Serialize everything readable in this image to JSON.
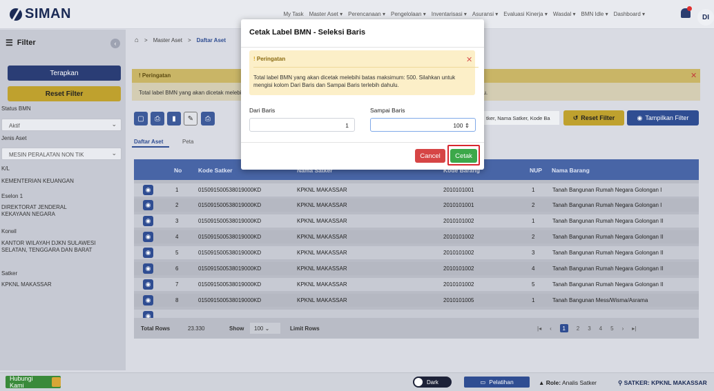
{
  "app": {
    "logo_text": "SIMAN"
  },
  "nav": {
    "items": [
      "My Task",
      "Master Aset ▾",
      "Perencanaan ▾",
      "Pengelolaan ▾",
      "Inventarisasi ▾",
      "Asuransi ▾",
      "Evaluasi Kinerja ▾",
      "Wasdal ▾",
      "BMN Idle ▾",
      "Dashboard ▾"
    ],
    "avatar": "DI"
  },
  "sidebar": {
    "title": "Filter",
    "terapkan": "Terapkan",
    "reset": "Reset Filter",
    "status_label": "Status BMN",
    "status_value": "Aktif",
    "jenis_label": "Jenis Aset",
    "jenis_value": "MESIN PERALATAN NON TIK",
    "kl_label": "K/L",
    "kl_value": "KEMENTERIAN KEUANGAN",
    "eselon_label": "Eselon 1",
    "eselon_value": "DIREKTORAT JENDERAL KEKAYAAN NEGARA",
    "korwil_label": "Korwil",
    "korwil_value": "KANTOR WILAYAH DJKN SULAWESI SELATAN, TENGGARA DAN BARAT",
    "satker_label": "Satker",
    "satker_value": "KPKNL MAKASSAR"
  },
  "breadcrumb": {
    "home": "⌂",
    "sep": ">",
    "item1": "Master Aset",
    "item2": "Daftar Aset"
  },
  "warning_bar": {
    "title": "Peringatan",
    "text": "Total label BMN yang akan dicetak melebihi batas maksimum: 500. Silahkan untuk mengisi kolom Dari Baris dan Sampai Baris terlebih dahulu."
  },
  "toolbar": {
    "search_placeholder": "tker, Nama Satker, Kode Ba",
    "reset_filter": "Reset Filter",
    "tampilkan_filter": "Tampilkan Filter"
  },
  "tabs": {
    "active": "Daftar Aset",
    "other": "Peta"
  },
  "table": {
    "headers": {
      "no": "No",
      "kode_satker": "Kode Satker",
      "nama_satker": "Nama Satker",
      "kode_barang": "Kode Barang",
      "nup": "NUP",
      "nama_barang": "Nama Barang"
    },
    "rows": [
      {
        "no": "1",
        "kode_satker": "015091500538019000KD",
        "nama_satker": "KPKNL MAKASSAR",
        "kode_barang": "2010101001",
        "nup": "1",
        "nama_barang": "Tanah Bangunan Rumah Negara Golongan I"
      },
      {
        "no": "2",
        "kode_satker": "015091500538019000KD",
        "nama_satker": "KPKNL MAKASSAR",
        "kode_barang": "2010101001",
        "nup": "2",
        "nama_barang": "Tanah Bangunan Rumah Negara Golongan I"
      },
      {
        "no": "3",
        "kode_satker": "015091500538019000KD",
        "nama_satker": "KPKNL MAKASSAR",
        "kode_barang": "2010101002",
        "nup": "1",
        "nama_barang": "Tanah Bangunan Rumah Negara Golongan II"
      },
      {
        "no": "4",
        "kode_satker": "015091500538019000KD",
        "nama_satker": "KPKNL MAKASSAR",
        "kode_barang": "2010101002",
        "nup": "2",
        "nama_barang": "Tanah Bangunan Rumah Negara Golongan II"
      },
      {
        "no": "5",
        "kode_satker": "015091500538019000KD",
        "nama_satker": "KPKNL MAKASSAR",
        "kode_barang": "2010101002",
        "nup": "3",
        "nama_barang": "Tanah Bangunan Rumah Negara Golongan II"
      },
      {
        "no": "6",
        "kode_satker": "015091500538019000KD",
        "nama_satker": "KPKNL MAKASSAR",
        "kode_barang": "2010101002",
        "nup": "4",
        "nama_barang": "Tanah Bangunan Rumah Negara Golongan II"
      },
      {
        "no": "7",
        "kode_satker": "015091500538019000KD",
        "nama_satker": "KPKNL MAKASSAR",
        "kode_barang": "2010101002",
        "nup": "5",
        "nama_barang": "Tanah Bangunan Rumah Negara Golongan II"
      },
      {
        "no": "8",
        "kode_satker": "015091500538019000KD",
        "nama_satker": "KPKNL MAKASSAR",
        "kode_barang": "2010101005",
        "nup": "1",
        "nama_barang": "Tanah Bangunan Mess/Wisma/Asrama"
      }
    ]
  },
  "table_footer": {
    "total_rows_label": "Total Rows",
    "total_rows": "23.330",
    "show_label": "Show",
    "show_value": "100",
    "limit_rows": "Limit Rows",
    "pages": [
      "1",
      "2",
      "3",
      "4",
      "5"
    ]
  },
  "bottom": {
    "hubungi": "Hubungi Kami",
    "dark": "Dark",
    "pelatihan": "Pelatihan",
    "role_label": "Role:",
    "role_value": "Analis Satker",
    "satker_label": "SATKER:",
    "satker_value": "KPKNL MAKASSAR"
  },
  "modal": {
    "title": "Cetak Label BMN - Seleksi Baris",
    "warning_title": "Peringatan",
    "warning_text": "Total label BMN yang akan dicetak melebihi batas maksimum: 500. Silahkan untuk mengisi kolom Dari Baris dan Sampai Baris terlebih dahulu.",
    "dari_label": "Dari Baris",
    "dari_value": "1",
    "sampai_label": "Sampai Baris",
    "sampai_value": "100",
    "cancel": "Cancel",
    "cetak": "Cetak"
  }
}
